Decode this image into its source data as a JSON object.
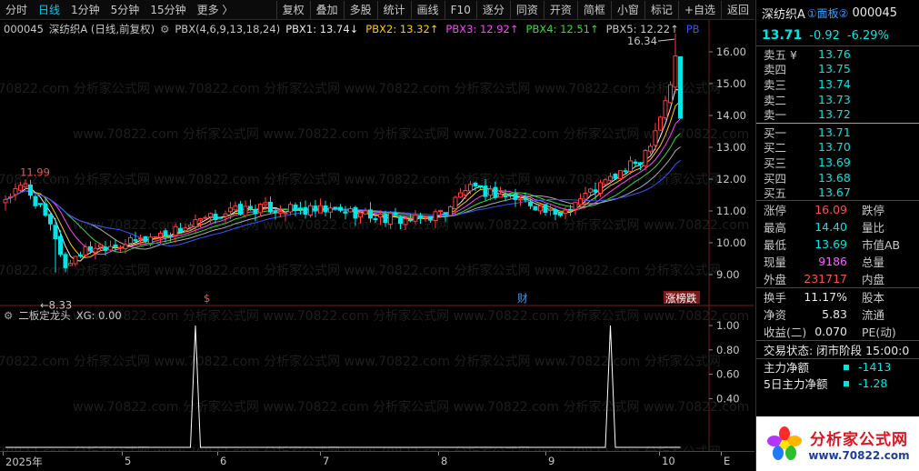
{
  "toolbar": {
    "periods": [
      "分时",
      "日线",
      "1分钟",
      "5分钟",
      "15分钟",
      "更多 〉"
    ],
    "active_period": "日线",
    "buttons": [
      "复权",
      "叠加",
      "多股",
      "统计",
      "画线",
      "F10",
      "逐分",
      "同资",
      "开资",
      "简框",
      "小窗",
      "标记",
      "+自选",
      "返回"
    ]
  },
  "main_chart": {
    "code": "000045",
    "title": "深纺织A (日线,前复权)",
    "indicator": "PBX(4,6,9,13,18,24)",
    "pbx": [
      {
        "label": "PBX1: 13.74",
        "arrow": "↓",
        "color": "#e8e8e8"
      },
      {
        "label": "PBX2: 13.32",
        "arrow": "↑",
        "color": "#ffcc00"
      },
      {
        "label": "PBX3: 12.92",
        "arrow": "↑",
        "color": "#ff44ff"
      },
      {
        "label": "PBX4: 12.51",
        "arrow": "↑",
        "color": "#33dd33"
      },
      {
        "label": "PBX5: 12.22",
        "arrow": "↑",
        "color": "#c8c8c8"
      },
      {
        "label": "PB",
        "arrow": "",
        "color": "#3355ff"
      }
    ],
    "y_ticks": [
      "16.00",
      "15.00",
      "14.00",
      "13.00",
      "12.00",
      "11.00",
      "10.00",
      "9.00"
    ],
    "high_label": "16.34",
    "left_high_label": "11.99",
    "low_label": "8.33",
    "markers": [
      {
        "text": "$",
        "color": "#ff4d4d"
      },
      {
        "text": "财",
        "color": "#3aa0ff"
      },
      {
        "text": "涨榜跌",
        "color": "#ffffff"
      }
    ],
    "watermark": "www.70822.com 分析家公式网"
  },
  "sub_chart": {
    "title": "二板定龙头",
    "xg": "XG: 0.00",
    "y_ticks": [
      "1.00",
      "0.80",
      "0.60",
      "0.40"
    ]
  },
  "x_axis": [
    "2025年",
    "5",
    "6",
    "7",
    "8",
    "9",
    "10",
    "E"
  ],
  "chart_data": {
    "type": "candlestick",
    "ylim": [
      8.2,
      16.6
    ],
    "period_labels": [
      "2025年",
      "5",
      "6",
      "7",
      "8",
      "9",
      "10"
    ],
    "highest": 16.34,
    "lowest": 8.33,
    "local_high": 11.99,
    "last_close": 13.71,
    "signal_series": {
      "name": "二板定龙头",
      "signals_at": [
        "6月初",
        "10月初"
      ],
      "value": 1.0
    }
  },
  "panel": {
    "name": "深纺织A",
    "tag": "①面板②",
    "code": "000045",
    "price": "13.71",
    "change": "-0.92",
    "change_pct": "-6.29%",
    "asks": [
      {
        "label": "卖五 ¥",
        "value": "13.76"
      },
      {
        "label": "卖四",
        "value": "13.75"
      },
      {
        "label": "卖三",
        "value": "13.74"
      },
      {
        "label": "卖二",
        "value": "13.73"
      },
      {
        "label": "卖一",
        "value": "13.72"
      }
    ],
    "bids": [
      {
        "label": "买一",
        "value": "13.71"
      },
      {
        "label": "买二",
        "value": "13.70"
      },
      {
        "label": "买三",
        "value": "13.69"
      },
      {
        "label": "买四",
        "value": "13.68"
      },
      {
        "label": "买五",
        "value": "13.67"
      }
    ],
    "stats": [
      {
        "l1": "涨停",
        "v1": "16.09",
        "c1": "red",
        "l2": "跌停"
      },
      {
        "l1": "最高",
        "v1": "14.40",
        "c1": "cyan",
        "l2": "量比"
      },
      {
        "l1": "最低",
        "v1": "13.69",
        "c1": "cyan",
        "l2": "市值AB"
      },
      {
        "l1": "现量",
        "v1": "9186",
        "c1": "mag",
        "l2": "总量"
      },
      {
        "l1": "外盘",
        "v1": "231717",
        "c1": "red",
        "l2": "内盘"
      }
    ],
    "stats2": [
      {
        "l1": "换手",
        "v1": "11.17%",
        "c1": "white",
        "l2": "股本"
      },
      {
        "l1": "净资",
        "v1": "5.83",
        "c1": "white",
        "l2": "流通"
      },
      {
        "l1": "收益(二)",
        "v1": "0.070",
        "c1": "white",
        "l2": "PE(动)"
      }
    ],
    "trade_state": "交易状态: 闭市阶段 15:00:0",
    "flows": [
      {
        "label": "主力净额",
        "value": "-1413"
      },
      {
        "label": "5日主力净额",
        "value": "-1.28"
      }
    ],
    "brand_name": "分析家公式网",
    "brand_url": "www.70822.com"
  }
}
